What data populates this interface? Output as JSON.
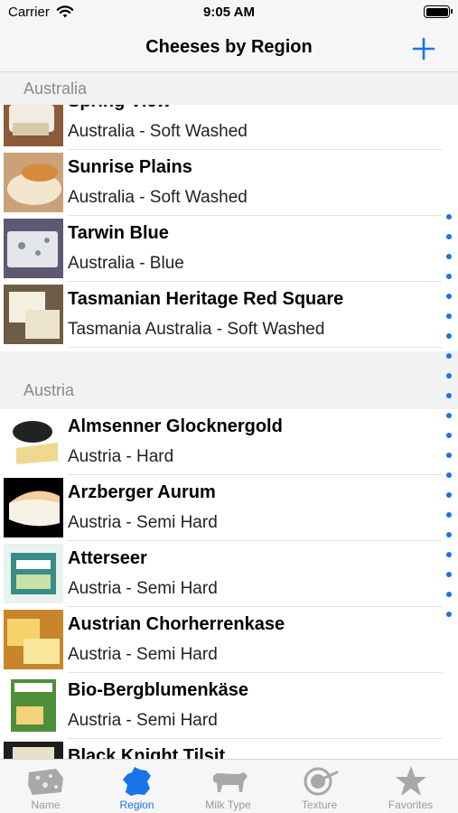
{
  "status_bar": {
    "carrier": "Carrier",
    "time": "9:05 AM"
  },
  "nav": {
    "title": "Cheeses by Region"
  },
  "colors": {
    "accent": "#1a73e8",
    "section_text": "#8a8a8e"
  },
  "sections": [
    {
      "title": "Australia",
      "items": [
        {
          "name": "Spring View",
          "subtitle": "Australia - Soft Washed"
        },
        {
          "name": "Sunrise Plains",
          "subtitle": "Australia - Soft Washed"
        },
        {
          "name": "Tarwin Blue",
          "subtitle": "Australia - Blue"
        },
        {
          "name": "Tasmanian Heritage Red Square",
          "subtitle": "Tasmania Australia - Soft Washed"
        }
      ]
    },
    {
      "title": "Austria",
      "items": [
        {
          "name": "Almsenner Glocknergold",
          "subtitle": "Austria - Hard"
        },
        {
          "name": "Arzberger Aurum",
          "subtitle": "Austria - Semi Hard"
        },
        {
          "name": "Atterseer",
          "subtitle": "Austria - Semi Hard"
        },
        {
          "name": "Austrian Chorherrenkase",
          "subtitle": "Austria - Semi Hard"
        },
        {
          "name": "Bio-Bergblumenkäse",
          "subtitle": "Austria - Semi Hard"
        },
        {
          "name": "Black Knight Tilsit",
          "subtitle": ""
        }
      ]
    }
  ],
  "tabs": [
    {
      "label": "Name",
      "icon": "cheese-icon",
      "active": false
    },
    {
      "label": "Region",
      "icon": "france-map-icon",
      "active": true
    },
    {
      "label": "Milk Type",
      "icon": "cow-icon",
      "active": false
    },
    {
      "label": "Texture",
      "icon": "texture-dial-icon",
      "active": false
    },
    {
      "label": "Favorites",
      "icon": "star-icon",
      "active": false
    }
  ]
}
